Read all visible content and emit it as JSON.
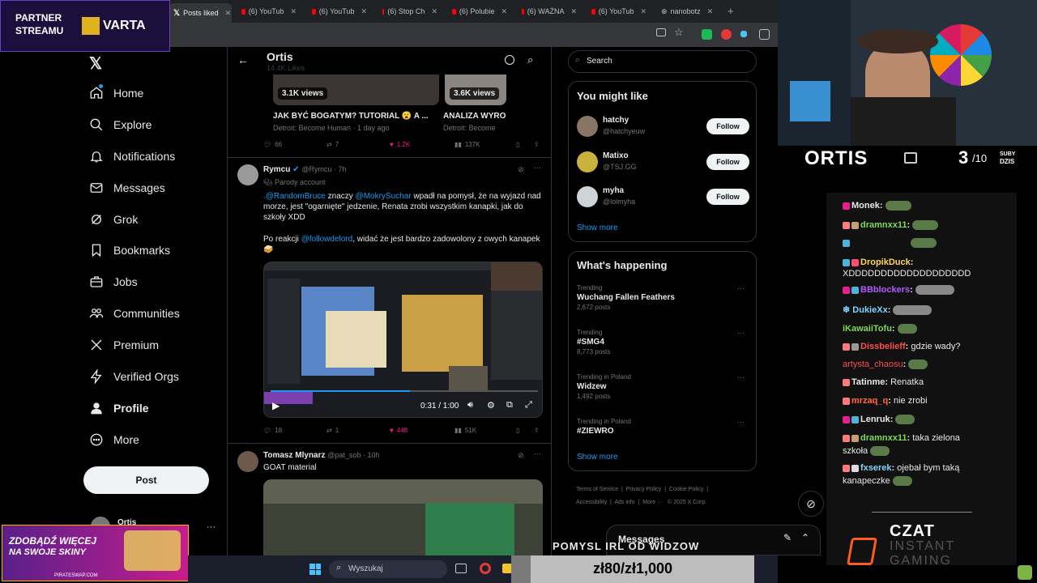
{
  "stream": {
    "partner_line1": "PARTNER",
    "partner_line2": "STREAMU",
    "sponsor": "VARTA",
    "streamer_name": "ORTIS",
    "subs_count": "3",
    "subs_total": "/10",
    "subs_label1": "SUBY",
    "subs_label2": "DZIS",
    "promo_line1": "ZDOBĄDŹ WIĘCEJ",
    "promo_line2": "NA SWOJE SKINY",
    "promo_site": "PIRATESWAP.COM",
    "ticker": "POMYSL IRL OD WIDZOW",
    "donation_goal": "zł80/zł1,000",
    "chat_brand_line1": "CZAT",
    "chat_brand_line2": "INSTANT",
    "chat_brand_line3": "GAMING"
  },
  "browser": {
    "tabs": [
      {
        "label": "Posts liked",
        "type": "x"
      },
      {
        "label": "(6) YouTub",
        "type": "yt"
      },
      {
        "label": "(6) YouTub",
        "type": "yt"
      },
      {
        "label": "(6) Stop Ch",
        "type": "yt"
      },
      {
        "label": "(6) Polubie",
        "type": "yt"
      },
      {
        "label": "(6) WAŻNA",
        "type": "yt"
      },
      {
        "label": "(6) YouTub",
        "type": "yt"
      },
      {
        "label": "nanobotz",
        "type": "web"
      }
    ],
    "new_tab": "+"
  },
  "sidebar": {
    "items": [
      {
        "label": "Home",
        "icon": "home-icon"
      },
      {
        "label": "Explore",
        "icon": "search-icon"
      },
      {
        "label": "Notifications",
        "icon": "bell-icon"
      },
      {
        "label": "Messages",
        "icon": "mail-icon"
      },
      {
        "label": "Grok",
        "icon": "grok-icon"
      },
      {
        "label": "Bookmarks",
        "icon": "bookmark-icon"
      },
      {
        "label": "Jobs",
        "icon": "briefcase-icon"
      },
      {
        "label": "Communities",
        "icon": "people-icon"
      },
      {
        "label": "Premium",
        "icon": "x-icon"
      },
      {
        "label": "Verified Orgs",
        "icon": "lightning-icon"
      },
      {
        "label": "Profile",
        "icon": "person-icon"
      },
      {
        "label": "More",
        "icon": "more-circle-icon"
      }
    ],
    "post_button": "Post",
    "account_name": "Ortis",
    "account_more": "···"
  },
  "header": {
    "title": "Ortis",
    "subtitle": "14.4K Likes"
  },
  "top_cards": [
    {
      "views": "3.1K views",
      "title": "JAK BYĆ BOGATYM? TUTORIAL 😮 A ...",
      "meta": "Detroit: Become Human · 1 day ago"
    },
    {
      "views": "3.6K views",
      "title": "ANALIZA WYRO",
      "meta": "Detroit: Become"
    }
  ],
  "top_actions": {
    "replies": "66",
    "reposts": "7",
    "likes": "1.2K",
    "views": "137K"
  },
  "tweet1": {
    "author": "Rymcu",
    "handle": "@Rymcu · 7h",
    "parody": "Parody account",
    "mention1": ".@RandomBruce",
    "text1": " znaczy ",
    "mention2": "@MokrySuchar",
    "text2": " wpadł na pomysł, że na wyjazd nad morze, jest \"ogarnięte\" jedzenie, Renata zrobi wszystkim kanapki, jak do szkoły XDD",
    "text3": "Po reakcji ",
    "mention3": "@followdelord",
    "text4": ", widać że jest bardzo zadowolony z owych kanapek 🥪",
    "video_time": "0:31 / 1:00",
    "replies": "18",
    "reposts": "1",
    "likes": "448",
    "views": "51K"
  },
  "tweet2": {
    "author": "Tomasz Mlynarz",
    "handle": "@pat_sob · 10h",
    "text": "GOAT material"
  },
  "search": {
    "placeholder": "Search"
  },
  "you_might_like": {
    "title": "You might like",
    "users": [
      {
        "name": "hatchy",
        "handle": "@hatchyeuw",
        "button": "Follow"
      },
      {
        "name": "Matixo",
        "handle": "@TSJ.GG",
        "button": "Follow"
      },
      {
        "name": "myha",
        "handle": "@lolmyha",
        "button": "Follow"
      }
    ],
    "show_more": "Show more"
  },
  "whats_happening": {
    "title": "What's happening",
    "trends": [
      {
        "context": "Trending",
        "name": "Wuchang Fallen Feathers",
        "posts": "2,672 posts"
      },
      {
        "context": "Trending",
        "name": "#SMG4",
        "posts": "8,773 posts"
      },
      {
        "context": "Trending in Poland",
        "name": "Widzew",
        "posts": "1,492 posts"
      },
      {
        "context": "Trending in Poland",
        "name": "#ZIEWRO",
        "posts": ""
      }
    ],
    "show_more": "Show more"
  },
  "footer_links": [
    "Terms of Service",
    "Privacy Policy",
    "Cookie Policy",
    "Accessibility",
    "Ads info",
    "More ···",
    "© 2025 X Corp."
  ],
  "messages_label": "Messages",
  "taskbar": {
    "search_placeholder": "Wyszukaj"
  },
  "chat": [
    {
      "user": "Monek",
      "color": "#e7e9ea",
      "msg": ""
    },
    {
      "user": "dramnxx11",
      "color": "#7ed957",
      "msg": ""
    },
    {
      "user": "",
      "color": "#e7e9ea",
      "msg": ""
    },
    {
      "user": "DropikDuck",
      "color": "#ffd84d",
      "msg": ""
    },
    {
      "user": "",
      "color": "#e7e9ea",
      "msg": "XDDDDDDDDDDDDDDDDDDD"
    },
    {
      "user": "BBblockers",
      "color": "#b15cff",
      "msg": ""
    },
    {
      "user": "DukieXx",
      "color": "#7fd4ff",
      "msg": ""
    },
    {
      "user": "iKawaiiTofu",
      "color": "#7ed957",
      "msg": ""
    },
    {
      "user": "Dissbelieff",
      "color": "#ff4d4d",
      "msg": "gdzie wady?"
    },
    {
      "user": "artysta_chaosu",
      "color": "#ff4d4d",
      "msg": ""
    },
    {
      "user": "Tatinme",
      "color": "#e7e9ea",
      "msg": "Renatka"
    },
    {
      "user": "mrzaq_q",
      "color": "#ff6a3d",
      "msg": "nie zrobi"
    },
    {
      "user": "Lenruk",
      "color": "#e7e9ea",
      "msg": ""
    },
    {
      "user": "dramnxx11",
      "color": "#7ed957",
      "msg": "taka zielona"
    },
    {
      "user": "",
      "color": "#e7e9ea",
      "msg": "szkoła"
    },
    {
      "user": "fxserek",
      "color": "#7fd4ff",
      "msg": "ojebał bym taką"
    },
    {
      "user": "",
      "color": "#e7e9ea",
      "msg": "kanapeczke"
    }
  ]
}
